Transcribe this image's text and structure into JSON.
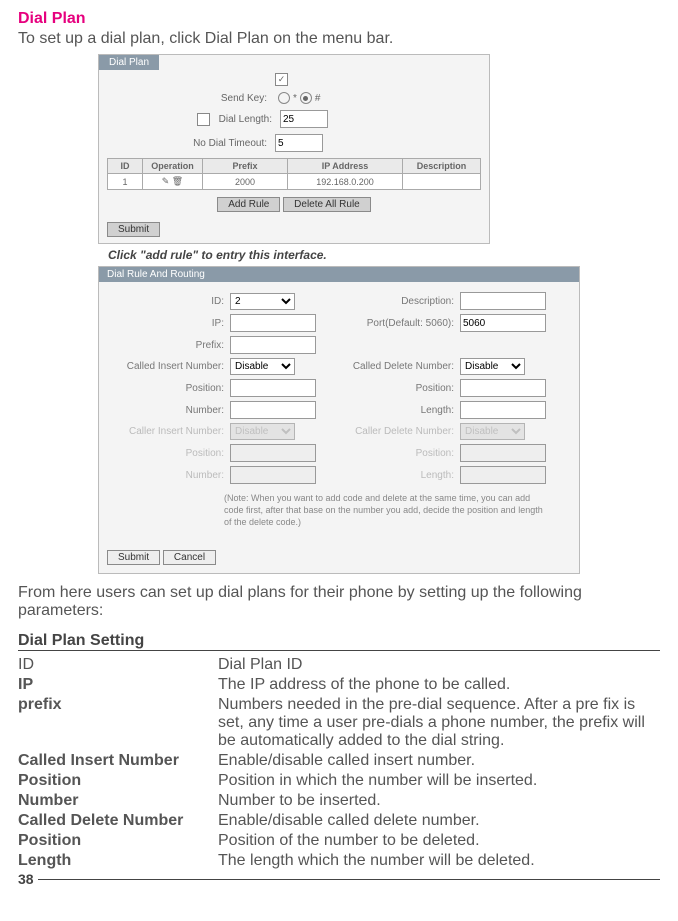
{
  "title": "Dial Plan",
  "intro": "To set up a dial plan, click Dial Plan on the menu bar.",
  "shot1": {
    "tab": "Dial Plan",
    "send_key_label": "Send Key:",
    "dial_length_label": "Dial Length:",
    "dial_length_value": "25",
    "no_dial_timeout_label": "No Dial Timeout:",
    "no_dial_timeout_value": "5",
    "cols": {
      "id": "ID",
      "op": "Operation",
      "prefix": "Prefix",
      "ip": "IP Address",
      "desc": "Description"
    },
    "row": {
      "id": "1",
      "op": "✎ 🗑",
      "prefix": "2000",
      "ip": "192.168.0.200",
      "desc": ""
    },
    "btn_add": "Add Rule",
    "btn_del_all": "Delete All Rule",
    "btn_submit": "Submit",
    "radio_star": "*",
    "radio_hash": "#"
  },
  "caption": "Click \"add rule\" to entry this interface.",
  "shot2": {
    "titlebar": "Dial Rule And Routing",
    "id_label": "ID:",
    "id_value": "2",
    "desc_label": "Description:",
    "ip_label": "IP:",
    "port_label": "Port(Default: 5060):",
    "port_value": "5060",
    "prefix_label": "Prefix:",
    "cin_label": "Called Insert Number:",
    "cin_value": "Disable",
    "cdn_label": "Called Delete Number:",
    "cdn_value": "Disable",
    "pos_label": "Position:",
    "num_label": "Number:",
    "len_label": "Length:",
    "caller_insert_label": "Caller Insert Number:",
    "caller_delete_label": "Caller Delete Number:",
    "caller_insert_value": "Disable",
    "caller_delete_value": "Disable",
    "note": "(Note: When you want to add code and delete at the same time, you can add code first, after that base on the number you add, decide the position and length of the delete code.)",
    "btn_submit": "Submit",
    "btn_cancel": "Cancel"
  },
  "from_here": "From here users can set up dial plans for their phone by setting up the following parameters:",
  "section_heading": "Dial Plan Setting",
  "settings": {
    "id_l": "ID",
    "id_v": "Dial Plan ID",
    "ip_l": "IP",
    "ip_v": "The IP address of the phone to be called.",
    "prefix_l": "prefix",
    "prefix_v": "Numbers needed in the pre-dial sequence. After a pre fix is set, any time a user pre-dials a phone number, the prefix will be automatically added to the dial string.",
    "cin_l": " Called Insert Number",
    "cin_v": "Enable/disable called insert number.",
    "pos1_l": "Position",
    "pos1_v": "Position in which the number will be inserted.",
    "num_l": "Number",
    "num_v": "Number to be inserted.",
    "cdn_l": "Called Delete Number",
    "cdn_v": "Enable/disable called delete number.",
    "pos2_l": "Position",
    "pos2_v": "Position of the number to be deleted.",
    "len_l": "Length",
    "len_v": "The length which the number will be deleted."
  },
  "page_number": "38"
}
